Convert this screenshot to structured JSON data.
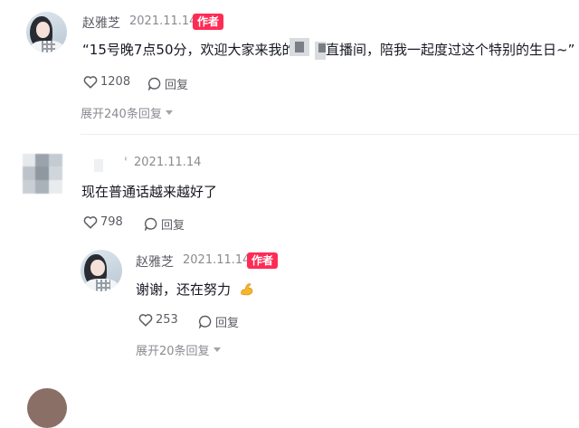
{
  "comments": [
    {
      "author": "赵雅芝",
      "date": "2021.11.14",
      "badge": "作者",
      "text_part1": "“15号晚7点50分，欢迎大家来我的",
      "text_part2": "直播间，陪我一起度过这个特别的生日~”",
      "likes": "1208",
      "reply_label": "回复",
      "expand_label": "展开240条回复"
    },
    {
      "author": "'",
      "date": "2021.11.14",
      "text": "现在普通话越来越好了",
      "likes": "798",
      "reply_label": "回复",
      "reply": {
        "author": "赵雅芝",
        "date": "2021.11.14",
        "badge": "作者",
        "text": "谢谢，还在努力",
        "emoji": "flexed-biceps-icon",
        "likes": "253",
        "reply_label": "回复",
        "expand_label": "展开20条回复"
      }
    }
  ],
  "colors": {
    "badge": "#fe2c55",
    "muted": "#8a8b91",
    "text": "#161823"
  }
}
